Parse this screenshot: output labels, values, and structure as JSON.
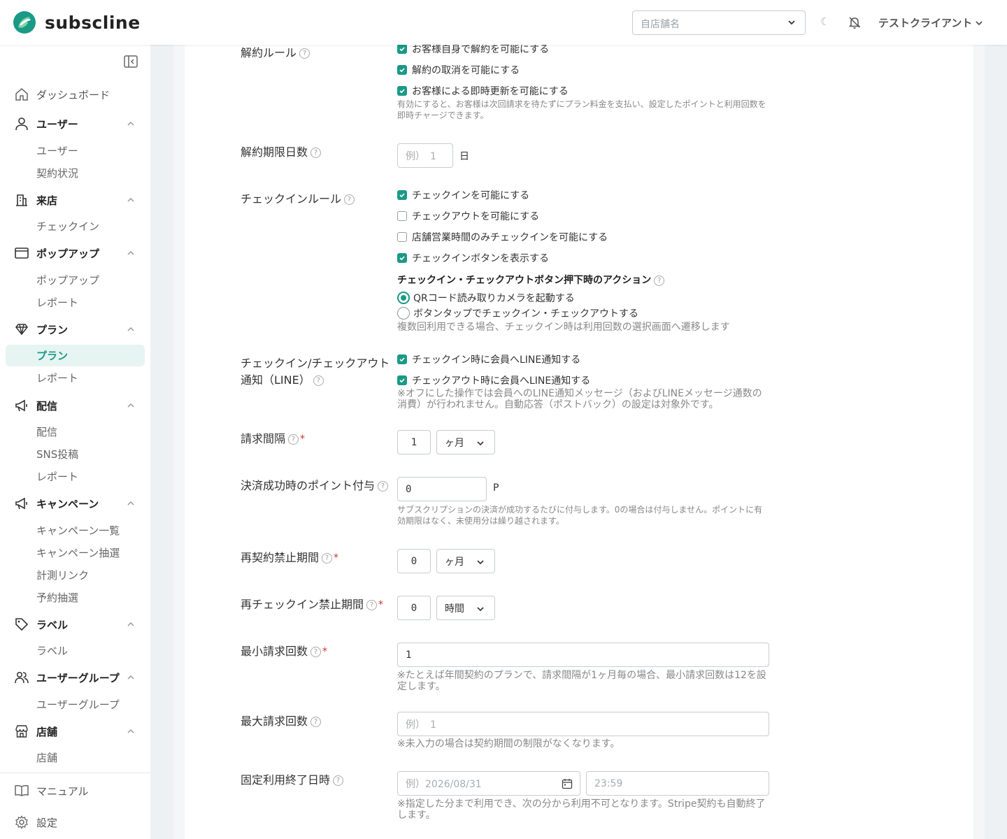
{
  "app": {
    "brand": "subscline",
    "accent": "#1a9a86"
  },
  "header": {
    "store_placeholder": "自店舗名",
    "theme_icon": "☾",
    "client_name": "テストクライアント"
  },
  "sidebar": {
    "dashboard": "ダッシュボード",
    "groups": {
      "user": {
        "label": "ユーザー",
        "items": [
          "ユーザー",
          "契約状況"
        ]
      },
      "visit": {
        "label": "来店",
        "items": [
          "チェックイン"
        ]
      },
      "popup": {
        "label": "ポップアップ",
        "items": [
          "ポップアップ",
          "レポート"
        ]
      },
      "plan": {
        "label": "プラン",
        "items": [
          "プラン",
          "レポート"
        ]
      },
      "delivery": {
        "label": "配信",
        "items": [
          "配信",
          "SNS投稿",
          "レポート"
        ]
      },
      "campaign": {
        "label": "キャンペーン",
        "items": [
          "キャンペーン一覧",
          "キャンペーン抽選",
          "計測リンク",
          "予約抽選"
        ]
      },
      "label": {
        "label": "ラベル",
        "items": [
          "ラベル"
        ]
      },
      "usergroup": {
        "label": "ユーザーグループ",
        "items": [
          "ユーザーグループ"
        ]
      },
      "store": {
        "label": "店舗",
        "items": [
          "店舗"
        ]
      }
    },
    "manual": "マニュアル",
    "settings": "設定"
  },
  "form": {
    "cancel_rule": {
      "label": "解約ルール",
      "options": [
        {
          "text": "お客様自身で解約を可能にする",
          "checked": true
        },
        {
          "text": "解約の取消を可能にする",
          "checked": true
        },
        {
          "text": "お客様による即時更新を可能にする",
          "checked": true
        }
      ],
      "note": "有効にすると、お客様は次回請求を待たずにプラン料金を支払い、設定したポイントと利用回数を即時チャージできます。"
    },
    "cancel_deadline": {
      "label": "解約期限日数",
      "placeholder": "例）　1",
      "unit": "日"
    },
    "checkin_rule": {
      "label": "チェックインルール",
      "options": [
        {
          "text": "チェックインを可能にする",
          "checked": true
        },
        {
          "text": "チェックアウトを可能にする",
          "checked": false
        },
        {
          "text": "店舗営業時間のみチェックインを可能にする",
          "checked": false
        },
        {
          "text": "チェックインボタンを表示する",
          "checked": true
        }
      ],
      "action_heading": "チェックイン・チェックアウトボタン押下時のアクション",
      "actions": [
        {
          "text": "QRコード読み取りカメラを起動する",
          "selected": true
        },
        {
          "text": "ボタンタップでチェックイン・チェックアウトする",
          "selected": false
        }
      ],
      "note": "複数回利用できる場合、チェックイン時は利用回数の選択画面へ遷移します"
    },
    "checkin_notify": {
      "label_line1": "チェックイン/チェックアウト",
      "label_line2": "通知（LINE）",
      "options": [
        {
          "text": "チェックイン時に会員へLINE通知する",
          "checked": true
        },
        {
          "text": "チェックアウト時に会員へLINE通知する",
          "checked": true
        }
      ],
      "note": "※オフにした操作では会員へのLINE通知メッセージ（およびLINEメッセージ通数の消費）が行われません。自動応答（ポストバック）の設定は対象外です。"
    },
    "billing_interval": {
      "label": "請求間隔",
      "value": "1",
      "unit": "ヶ月"
    },
    "payment_points": {
      "label": "決済成功時のポイント付与",
      "value": "0",
      "unit": "P",
      "note": "サブスクリプションの決済が成功するたびに付与します。0の場合は付与しません。ポイントに有効期限はなく、未使用分は繰り越されます。"
    },
    "recontract_ban": {
      "label": "再契約禁止期間",
      "value": "0",
      "unit": "ヶ月"
    },
    "recheckin_ban": {
      "label": "再チェックイン禁止期間",
      "value": "0",
      "unit": "時間"
    },
    "min_billing": {
      "label": "最小請求回数",
      "value": "1",
      "note": "※たとえば年間契約のプランで、請求間隔が1ヶ月毎の場合、最小請求回数は12を設定します。"
    },
    "max_billing": {
      "label": "最大請求回数",
      "placeholder": "例）　1",
      "note": "※未入力の場合は契約期間の制限がなくなります。"
    },
    "fixed_end": {
      "label": "固定利用終了日時",
      "date_placeholder": "例）2026/08/31",
      "time_placeholder": "23:59",
      "note": "※指定した分まで利用でき、次の分から利用不可となります。Stripe契約も自動終了します。"
    }
  }
}
